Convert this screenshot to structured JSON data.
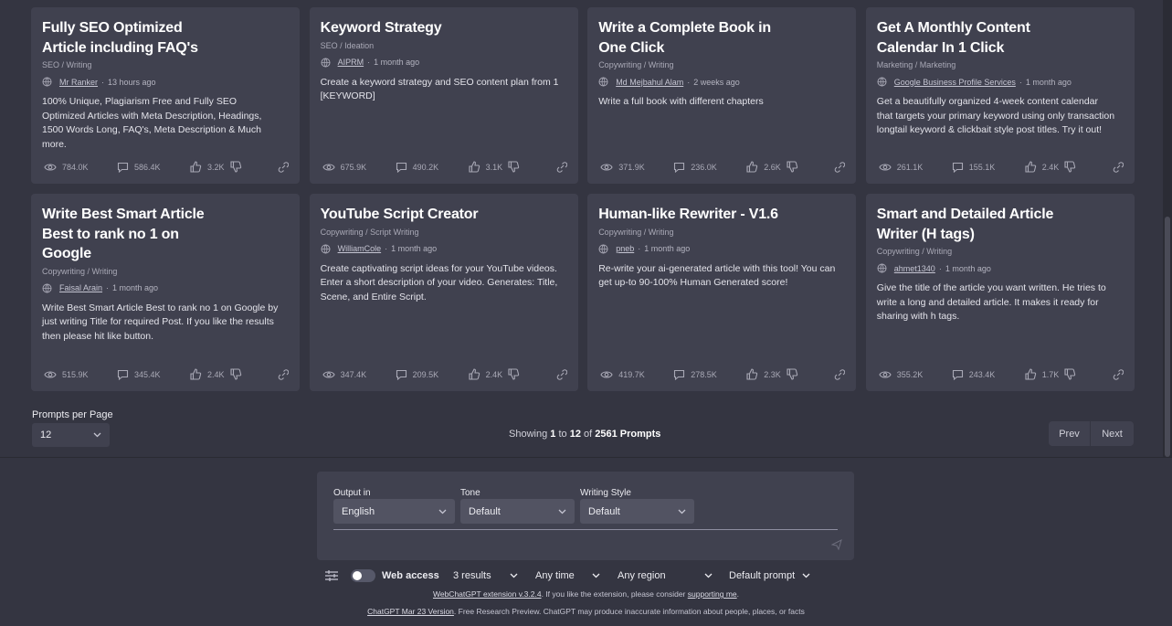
{
  "cards": [
    {
      "title": "Fully SEO Optimized Article including FAQ's",
      "category": "SEO / Writing",
      "author": "Mr Ranker",
      "time": "13 hours ago",
      "description": "100% Unique, Plagiarism Free and Fully SEO Optimized Articles with Meta Description, Headings, 1500 Words Long, FAQ's, Meta Description & Much more.",
      "views": "784.0K",
      "comments": "586.4K",
      "likes": "3.2K"
    },
    {
      "title": "Keyword Strategy",
      "category": "SEO / Ideation",
      "author": "AIPRM",
      "time": "1 month ago",
      "description": "Create a keyword strategy and SEO content plan from 1 [KEYWORD]",
      "views": "675.9K",
      "comments": "490.2K",
      "likes": "3.1K"
    },
    {
      "title": "Write a Complete Book in One Click",
      "category": "Copywriting / Writing",
      "author": "Md Mejbahul Alam",
      "time": "2 weeks ago",
      "description": "Write a full book with different chapters",
      "views": "371.9K",
      "comments": "236.0K",
      "likes": "2.6K"
    },
    {
      "title": "Get A Monthly Content Calendar In 1 Click",
      "category": "Marketing / Marketing",
      "author": "Google Business Profile Services",
      "time": "1 month ago",
      "description": "Get a beautifully organized 4-week content calendar that targets your primary keyword using only transaction longtail keyword & clickbait style post titles. Try it out!",
      "views": "261.1K",
      "comments": "155.1K",
      "likes": "2.4K"
    },
    {
      "title": "Write Best Smart Article Best to rank no 1 on Google",
      "category": "Copywriting / Writing",
      "author": "Faisal Arain",
      "time": "1 month ago",
      "description": "Write Best Smart Article Best to rank no 1 on Google by just writing Title for required Post. If you like the results then please hit like button.",
      "views": "515.9K",
      "comments": "345.4K",
      "likes": "2.4K"
    },
    {
      "title": "YouTube Script Creator",
      "category": "Copywriting / Script Writing",
      "author": "WilliamCole",
      "time": "1 month ago",
      "description": "Create captivating script ideas for your YouTube videos. Enter a short description of your video. Generates: Title, Scene, and Entire Script.",
      "views": "347.4K",
      "comments": "209.5K",
      "likes": "2.4K"
    },
    {
      "title": "Human-like Rewriter - V1.6",
      "category": "Copywriting / Writing",
      "author": "pneb",
      "time": "1 month ago",
      "description": "Re-write your ai-generated article with this tool! You can get up-to 90-100% Human Generated score!",
      "views": "419.7K",
      "comments": "278.5K",
      "likes": "2.3K"
    },
    {
      "title": "Smart and Detailed Article Writer (H tags)",
      "category": "Copywriting / Writing",
      "author": "ahmet1340",
      "time": "1 month ago",
      "description": "Give the title of the article you want written. He tries to write a long and detailed article. It makes it ready for sharing with h tags.",
      "views": "355.2K",
      "comments": "243.4K",
      "likes": "1.7K"
    }
  ],
  "pagination": {
    "per_page_label": "Prompts per Page",
    "per_page_value": "12",
    "showing_prefix": "Showing",
    "from": "1",
    "to_word": "to",
    "to": "12",
    "of_word": "of",
    "total": "2561 Prompts",
    "prev_label": "Prev",
    "next_label": "Next"
  },
  "composer": {
    "output_label": "Output in",
    "output_value": "English",
    "tone_label": "Tone",
    "tone_value": "Default",
    "style_label": "Writing Style",
    "style_value": "Default"
  },
  "toolbar": {
    "web_access_label": "Web access",
    "web_access_on": false,
    "results": "3 results",
    "time": "Any time",
    "region": "Any region",
    "prompt": "Default prompt"
  },
  "footer": {
    "ext_link": "WebChatGPT extension v.3.2.4",
    "ext_text": ". If you like the extension, please consider ",
    "support_link": "supporting me",
    "support_end": ".",
    "version_link": "ChatGPT Mar 23 Version",
    "version_text": ". Free Research Preview. ChatGPT may produce inaccurate information about people, places, or facts"
  },
  "colors": {
    "background": "#343541",
    "card": "#40414f",
    "dropdown": "#525362"
  }
}
